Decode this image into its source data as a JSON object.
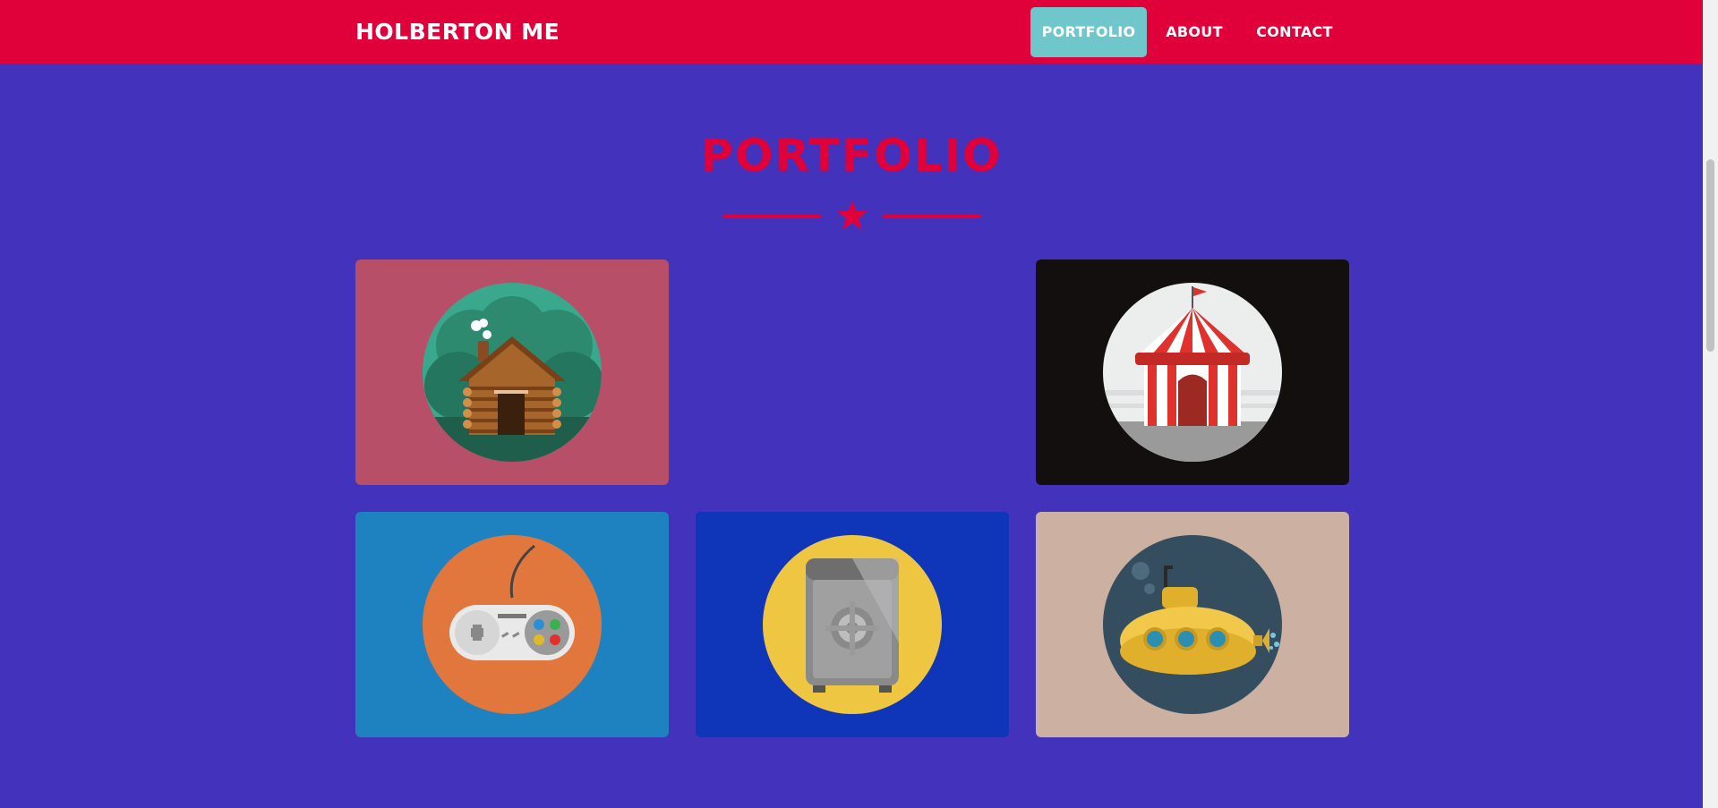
{
  "navbar": {
    "brand": "HOLBERTON ME",
    "links": [
      {
        "label": "PORTFOLIO",
        "active": true
      },
      {
        "label": "ABOUT",
        "active": false
      },
      {
        "label": "CONTACT",
        "active": false
      }
    ]
  },
  "portfolio": {
    "title": "PORTFOLIO",
    "items": [
      {
        "icon": "log-cabin-icon",
        "background": "#b84f68"
      },
      {
        "icon": "circus-tent-icon",
        "background": "#130f0e"
      },
      {
        "icon": "game-controller-icon",
        "background": "#1f82c0"
      },
      {
        "icon": "safe-icon",
        "background": "#0f35b8"
      },
      {
        "icon": "submarine-icon",
        "background": "#ccb0a2"
      }
    ]
  },
  "colors": {
    "page_background": "#4232bc",
    "navbar": "#e0003a",
    "accent": "#e0003a",
    "active_link": "#6fc7cc"
  }
}
